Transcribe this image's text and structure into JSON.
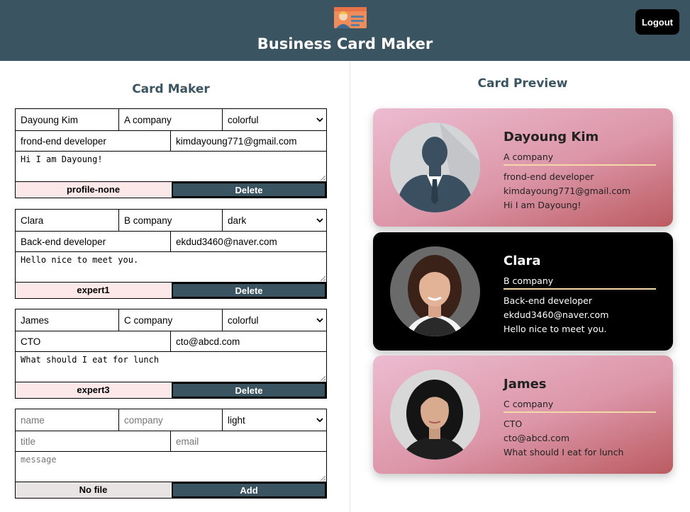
{
  "header": {
    "logo_icon": "business-card-logo-icon",
    "title": "Business Card Maker",
    "logout_label": "Logout"
  },
  "maker": {
    "title": "Card Maker",
    "cards": [
      {
        "name": "Dayoung Kim",
        "company": "A company",
        "theme": "colorful",
        "title": "frond-end developer",
        "email": "kimdayoung771@gmail.com",
        "message": "Hi I am Dayoung!",
        "file": "profile-none",
        "action": "Delete"
      },
      {
        "name": "Clara",
        "company": "B company",
        "theme": "dark",
        "title": "Back-end developer",
        "email": "ekdud3460@naver.com",
        "message": "Hello nice to meet you.",
        "file": "expert1",
        "action": "Delete"
      },
      {
        "name": "James",
        "company": "C company",
        "theme": "colorful",
        "title": "CTO",
        "email": "cto@abcd.com",
        "message": "What should I eat for lunch",
        "file": "expert3",
        "action": "Delete"
      }
    ],
    "add_form": {
      "name_placeholder": "name",
      "company_placeholder": "company",
      "theme": "light",
      "title_placeholder": "title",
      "email_placeholder": "email",
      "message_placeholder": "message",
      "file": "No file",
      "action": "Add"
    }
  },
  "preview": {
    "title": "Card Preview",
    "cards": [
      {
        "name": "Dayoung Kim",
        "company": "A company",
        "title": "frond-end developer",
        "email": "kimdayoung771@gmail.com",
        "message": "Hi I am Dayoung!",
        "theme": "colorful",
        "avatar": "default-profile-icon"
      },
      {
        "name": "Clara",
        "company": "B company",
        "title": "Back-end developer",
        "email": "ekdud3460@naver.com",
        "message": "Hello nice to meet you.",
        "theme": "dark",
        "avatar": "profile-photo"
      },
      {
        "name": "James",
        "company": "C company",
        "title": "CTO",
        "email": "cto@abcd.com",
        "message": "What should I eat for lunch",
        "theme": "colorful",
        "avatar": "profile-photo"
      }
    ]
  },
  "colors": {
    "header_bg": "#3b5462",
    "accent_title": "#3b5462",
    "file_button_bg": "#fce8e8",
    "delete_button_bg": "#3b5462",
    "card_divider": "#f5d8a8",
    "colorful_card": "#dc96a8",
    "dark_card": "#000000"
  }
}
